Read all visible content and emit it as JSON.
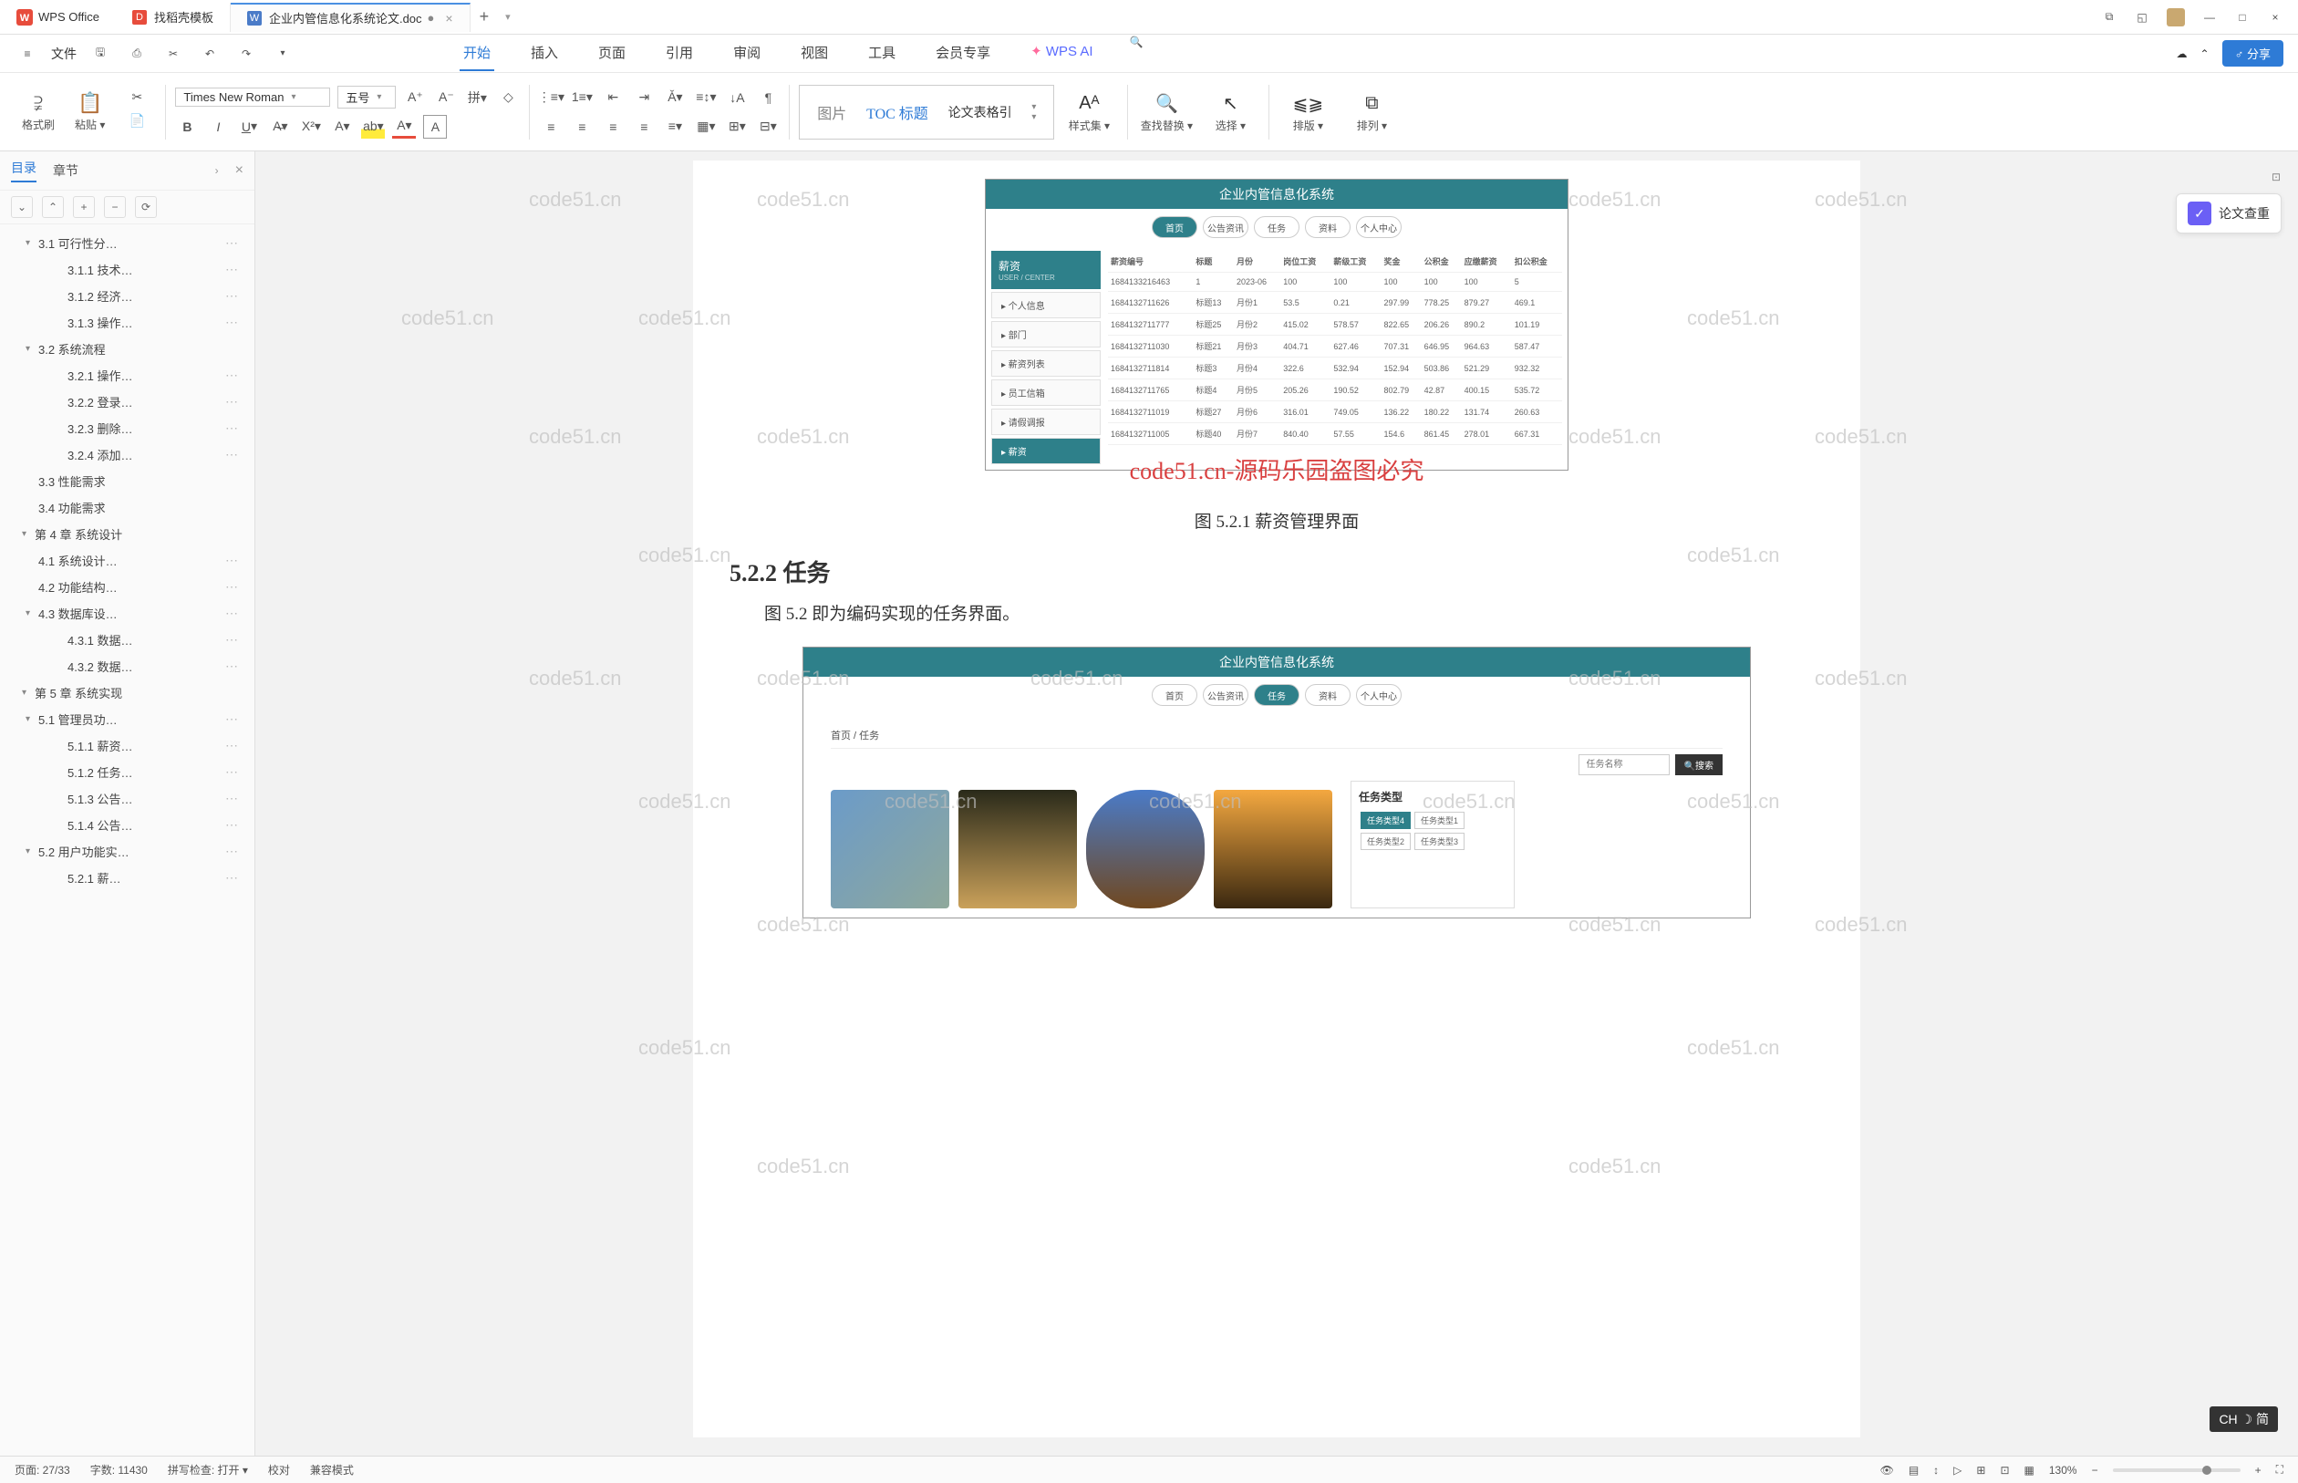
{
  "titleBar": {
    "appName": "WPS Office",
    "tabs": [
      {
        "icon": "D",
        "iconBg": "#e74c3c",
        "label": "找稻壳模板"
      },
      {
        "icon": "W",
        "iconBg": "#4a7bc8",
        "label": "企业内管信息化系统论文.doc",
        "active": true,
        "modified": true
      }
    ]
  },
  "menuBar": {
    "fileLabel": "文件",
    "tabs": [
      "开始",
      "插入",
      "页面",
      "引用",
      "审阅",
      "视图",
      "工具",
      "会员专享"
    ],
    "activeTab": "开始",
    "wpsAi": "WPS AI",
    "shareLabel": "分享"
  },
  "ribbon": {
    "formatPainter": "格式刷",
    "paste": "粘贴",
    "fontName": "Times New Roman",
    "fontSize": "五号",
    "stylePic": "图片",
    "styleToc": "TOC 标题",
    "styleThesis": "论文表格引",
    "styleSet": "样式集",
    "findReplace": "查找替换",
    "select": "选择",
    "layout": "排版",
    "arrange": "排列"
  },
  "sidebar": {
    "tabs": [
      "目录",
      "章节"
    ],
    "activeTab": "目录",
    "toc": [
      {
        "level": 1,
        "expand": "▾",
        "text": "3.1 可行性分…",
        "dots": true
      },
      {
        "level": 2,
        "text": "3.1.1 技术…",
        "dots": true
      },
      {
        "level": 2,
        "text": "3.1.2 经济…",
        "dots": true
      },
      {
        "level": 2,
        "text": "3.1.3 操作…",
        "dots": true
      },
      {
        "level": 1,
        "expand": "▾",
        "text": "3.2 系统流程"
      },
      {
        "level": 2,
        "text": "3.2.1 操作…",
        "dots": true
      },
      {
        "level": 2,
        "text": "3.2.2 登录…",
        "dots": true
      },
      {
        "level": 2,
        "text": "3.2.3 删除…",
        "dots": true
      },
      {
        "level": 2,
        "text": "3.2.4 添加…",
        "dots": true
      },
      {
        "level": 1,
        "text": "3.3 性能需求"
      },
      {
        "level": 1,
        "text": "3.4 功能需求"
      },
      {
        "level": 0,
        "expand": "▾",
        "text": "第 4 章  系统设计"
      },
      {
        "level": 1,
        "text": "4.1 系统设计…",
        "dots": true
      },
      {
        "level": 1,
        "text": "4.2 功能结构…",
        "dots": true
      },
      {
        "level": 1,
        "expand": "▾",
        "text": "4.3 数据库设…",
        "dots": true
      },
      {
        "level": 2,
        "text": "4.3.1 数据…",
        "dots": true
      },
      {
        "level": 2,
        "text": "4.3.2 数据…",
        "dots": true
      },
      {
        "level": 0,
        "expand": "▾",
        "text": "第 5 章  系统实现"
      },
      {
        "level": 1,
        "expand": "▾",
        "text": "5.1 管理员功…",
        "dots": true
      },
      {
        "level": 2,
        "text": "5.1.1 薪资…",
        "dots": true
      },
      {
        "level": 2,
        "text": "5.1.2 任务…",
        "dots": true
      },
      {
        "level": 2,
        "text": "5.1.3 公告…",
        "dots": true
      },
      {
        "level": 2,
        "text": "5.1.4 公告…",
        "dots": true
      },
      {
        "level": 1,
        "expand": "▾",
        "text": "5.2 用户功能实…",
        "dots": true
      },
      {
        "level": 2,
        "text": "5.2.1 薪…",
        "dots": true
      }
    ]
  },
  "document": {
    "watermarkText": "code51.cn",
    "redWatermark": "code51.cn-源码乐园盗图必究",
    "screenshot1": {
      "title": "企业内管信息化系统",
      "nav": [
        "首页",
        "公告资讯",
        "任务",
        "资料",
        "个人中心"
      ],
      "activeNav": "首页",
      "sideHeader": "薪资",
      "sideSub": "USER / CENTER",
      "sideItems": [
        "个人信息",
        "部门",
        "薪资列表",
        "员工信箱",
        "请假调报",
        "薪资"
      ],
      "activeSide": "薪资",
      "tableHeaders": [
        "薪资编号",
        "标题",
        "月份",
        "岗位工资",
        "薪级工资",
        "奖金",
        "公积金",
        "应缴薪资",
        "扣公积金"
      ],
      "tableRows": [
        [
          "1684133216463",
          "1",
          "2023-06",
          "100",
          "100",
          "100",
          "100",
          "100",
          "5"
        ],
        [
          "1684132711626",
          "标题13",
          "月份1",
          "53.5",
          "0.21",
          "297.99",
          "778.25",
          "879.27",
          "469.1"
        ],
        [
          "1684132711777",
          "标题25",
          "月份2",
          "415.02",
          "578.57",
          "822.65",
          "206.26",
          "890.2",
          "101.19"
        ],
        [
          "1684132711030",
          "标题21",
          "月份3",
          "404.71",
          "627.46",
          "707.31",
          "646.95",
          "964.63",
          "587.47"
        ],
        [
          "1684132711814",
          "标题3",
          "月份4",
          "322.6",
          "532.94",
          "152.94",
          "503.86",
          "521.29",
          "932.32"
        ],
        [
          "1684132711765",
          "标题4",
          "月份5",
          "205.26",
          "190.52",
          "802.79",
          "42.87",
          "400.15",
          "535.72"
        ],
        [
          "1684132711019",
          "标题27",
          "月份6",
          "316.01",
          "749.05",
          "136.22",
          "180.22",
          "131.74",
          "260.63"
        ],
        [
          "1684132711005",
          "标题40",
          "月份7",
          "840.40",
          "57.55",
          "154.6",
          "861.45",
          "278.01",
          "667.31"
        ]
      ]
    },
    "caption1": "图 5.2.1  薪资管理界面",
    "heading": "5.2.2  任务",
    "bodyText": "图 5.2  即为编码实现的任务界面。",
    "screenshot2": {
      "title": "企业内管信息化系统",
      "nav": [
        "首页",
        "公告资讯",
        "任务",
        "资料",
        "个人中心"
      ],
      "activeNav": "任务",
      "crumb": "首页 / 任务",
      "searchPlaceholder": "任务名称",
      "searchBtn": "搜索",
      "typeTitle": "任务类型",
      "typeTags": [
        "任务类型4",
        "任务类型1",
        "任务类型2",
        "任务类型3"
      ],
      "activeType": "任务类型4"
    }
  },
  "rightPanel": {
    "checkLabel": "论文查重"
  },
  "statusBar": {
    "page": "页面: 27/33",
    "words": "字数: 11430",
    "spell": "拼写检查: 打开",
    "proof": "校对",
    "compat": "兼容模式",
    "zoom": "130%"
  },
  "ime": "CH ☽ 简"
}
